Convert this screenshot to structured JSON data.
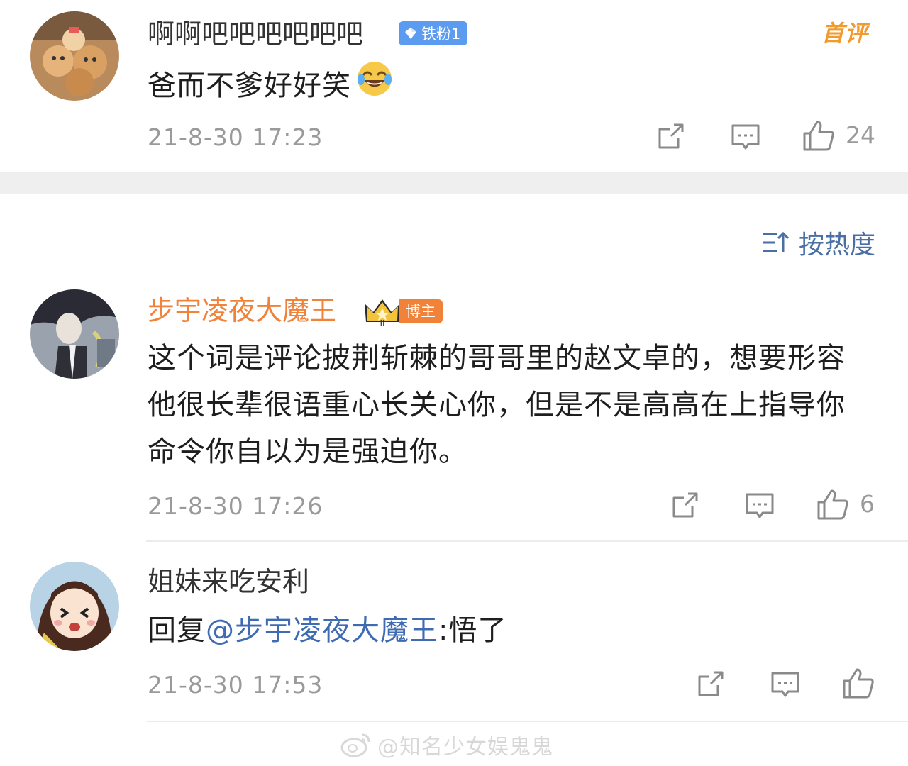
{
  "comments": [
    {
      "username": "啊啊吧吧吧吧吧吧",
      "fan_badge": "铁粉1",
      "first_badge": "首评",
      "text": "爸而不爹好好笑",
      "emoji": "laughing-tears-emoji",
      "time": "21-8-30 17:23",
      "likes": "24"
    },
    {
      "username": "步宇凌夜大魔王",
      "owner_badge": "博主",
      "text": "这个词是评论披荆斩棘的哥哥里的赵文卓的，想要形容他很长辈很语重心长关心你，但是不是高高在上指导你命令你自以为是强迫你。",
      "time": "21-8-30 17:26",
      "likes": "6"
    },
    {
      "username": "姐妹来吃安利",
      "reply_prefix": "回复",
      "mention": "@步宇凌夜大魔王",
      "reply_text": ":悟了",
      "time": "21-8-30 17:53",
      "likes": ""
    }
  ],
  "sort_label": "按热度",
  "watermark": "@知名少女娱鬼鬼",
  "colors": {
    "owner_name": "#f0823a",
    "mention": "#3f6bb3",
    "fan_badge": "#5b9bf0",
    "first_badge": "#f29a2e",
    "muted": "#9a9a9a"
  }
}
